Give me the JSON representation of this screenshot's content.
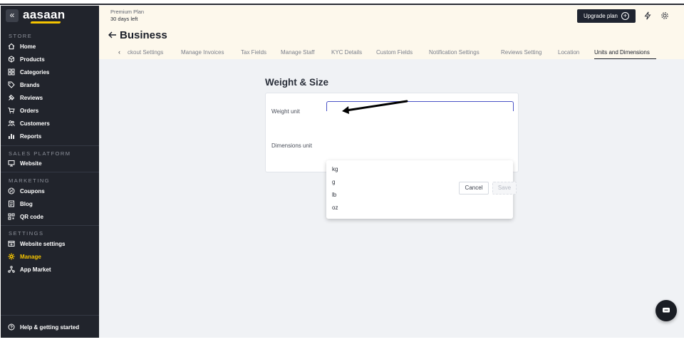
{
  "sidebar": {
    "collapse_icon": "double-chevron-left-icon",
    "logo": "aasaan",
    "sections": {
      "store": "STORE",
      "sales_platform": "SALES PLATFORM",
      "marketing": "MARKETING",
      "settings": "SETTINGS"
    },
    "store_items": [
      {
        "label": "Home",
        "icon": "home-icon"
      },
      {
        "label": "Products",
        "icon": "products-icon"
      },
      {
        "label": "Categories",
        "icon": "categories-icon"
      },
      {
        "label": "Brands",
        "icon": "tag-icon"
      },
      {
        "label": "Reviews",
        "icon": "reviews-icon"
      },
      {
        "label": "Orders",
        "icon": "cart-icon"
      },
      {
        "label": "Customers",
        "icon": "customers-icon"
      },
      {
        "label": "Reports",
        "icon": "chart-icon"
      }
    ],
    "sales_items": [
      {
        "label": "Website",
        "icon": "monitor-icon"
      }
    ],
    "marketing_items": [
      {
        "label": "Coupons",
        "icon": "coupon-icon"
      },
      {
        "label": "Blog",
        "icon": "blog-icon"
      },
      {
        "label": "QR code",
        "icon": "qr-code-icon"
      }
    ],
    "settings_items": [
      {
        "label": "Website settings",
        "icon": "website-settings-icon"
      },
      {
        "label": "Manage",
        "icon": "gear-icon",
        "active": true
      },
      {
        "label": "App Market",
        "icon": "app-market-icon"
      }
    ],
    "help": {
      "label": "Help & getting started",
      "icon": "help-icon"
    },
    "active_color": "#f5c400"
  },
  "header": {
    "plan_name": "Premium Plan",
    "plan_days": "30 days left",
    "upgrade_label": "Upgrade plan",
    "title": "Business",
    "tabs": [
      "ckout Settings",
      "Manage Invoices",
      "Tax Fields",
      "Manage Staff",
      "KYC Details",
      "Custom Fields",
      "Notification Settings",
      "Reviews Setting",
      "Location",
      "Units and Dimensions"
    ],
    "active_tab": "Units and Dimensions"
  },
  "main": {
    "section_title": "Weight & Size",
    "weight_label": "Weight unit",
    "dimensions_label": "Dimensions unit",
    "dropdown_options": [
      "kg",
      "g",
      "lb",
      "oz"
    ],
    "cancel_label": "Cancel",
    "save_label": "Save"
  },
  "colors": {
    "sidebar_bg": "#21242c",
    "header_bg": "#fdf8ec",
    "main_bg": "#f0f2f5",
    "focus_border": "#4a53c6"
  }
}
